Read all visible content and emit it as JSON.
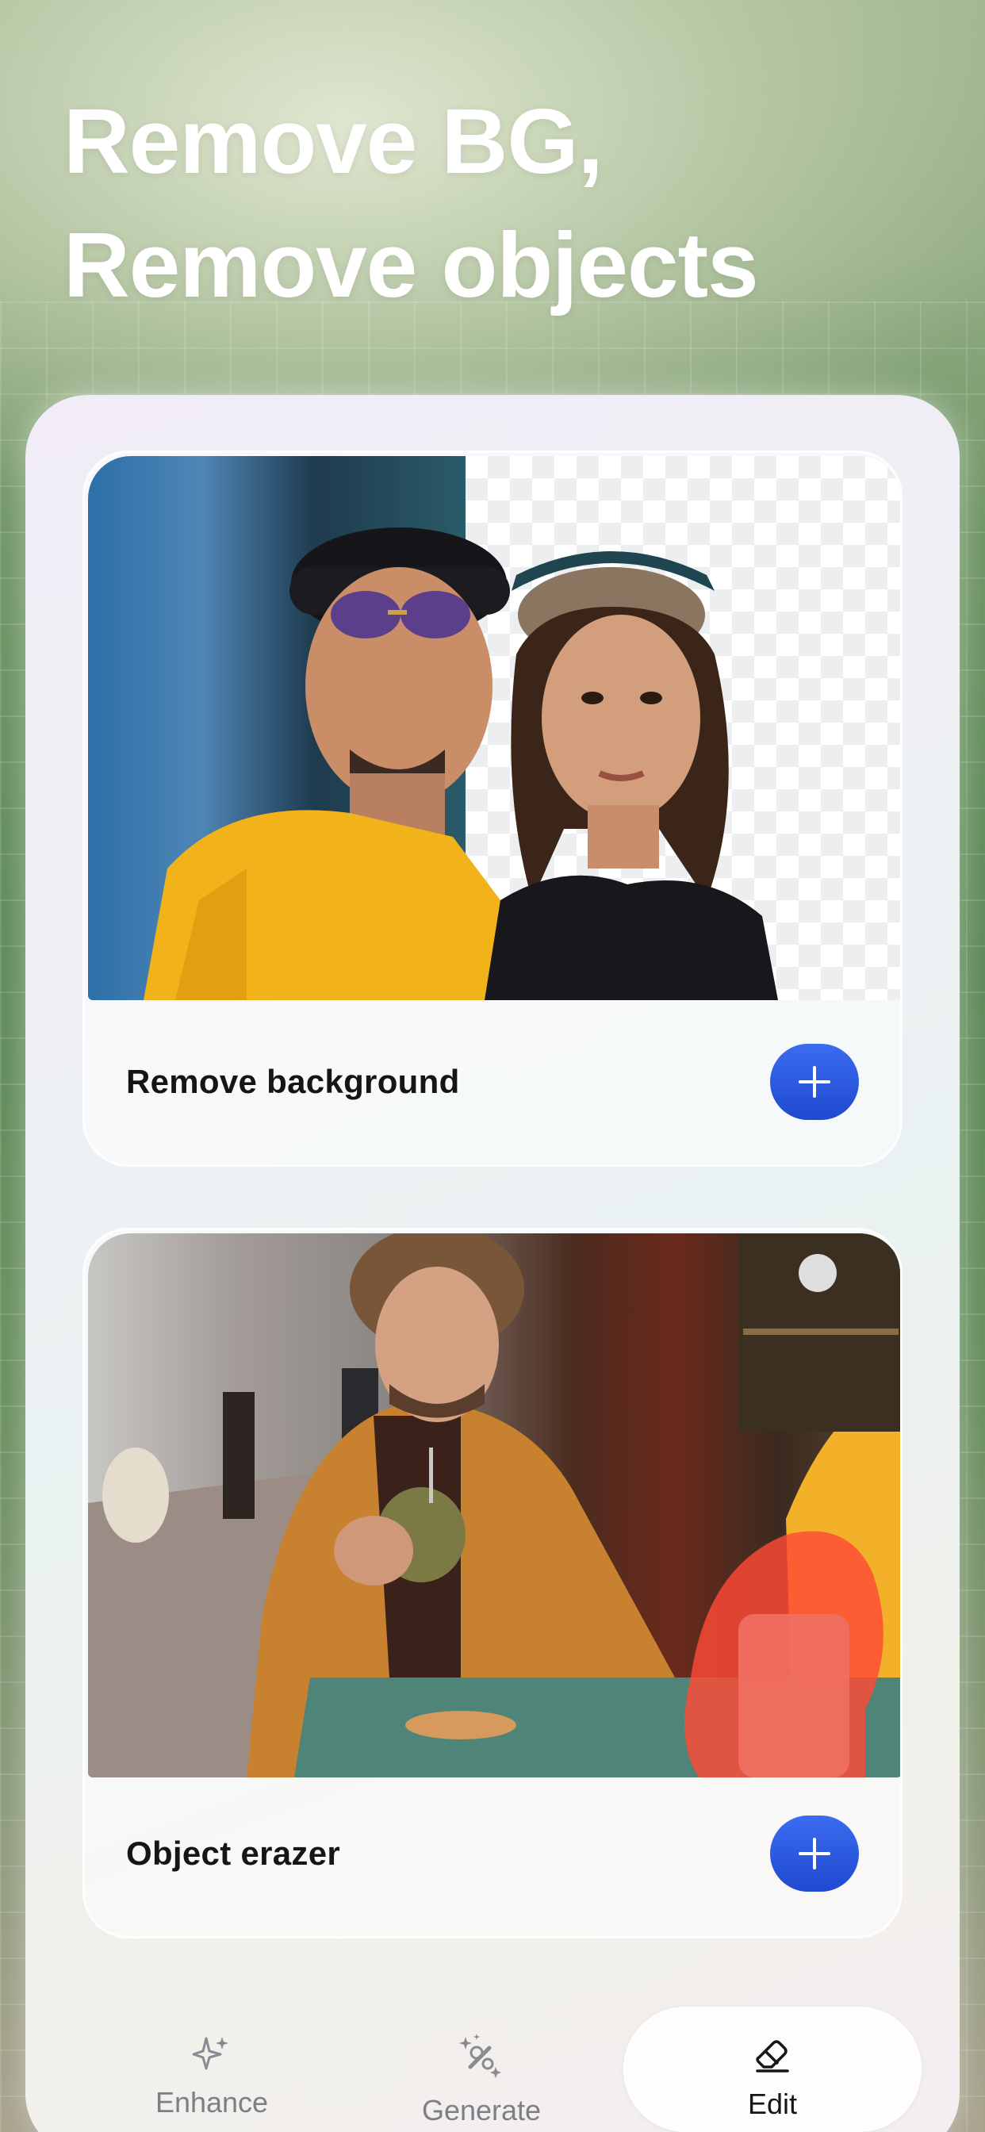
{
  "headline": {
    "line1": "Remove BG,",
    "line2": "Remove objects"
  },
  "cards": [
    {
      "title": "Remove background",
      "button_icon": "plus-icon"
    },
    {
      "title": "Object erazer",
      "button_icon": "plus-icon"
    }
  ],
  "nav": {
    "items": [
      {
        "label": "Enhance",
        "icon": "sparkle-icon",
        "active": false
      },
      {
        "label": "Generate",
        "icon": "wand-sparkle-icon",
        "active": false
      },
      {
        "label": "Edit",
        "icon": "eraser-icon",
        "active": true
      }
    ]
  },
  "colors": {
    "accent": "#2a58de",
    "nav_active_text": "#161616",
    "nav_inactive_text": "#7e7e86",
    "eraser_highlight": "#ff4a36"
  }
}
